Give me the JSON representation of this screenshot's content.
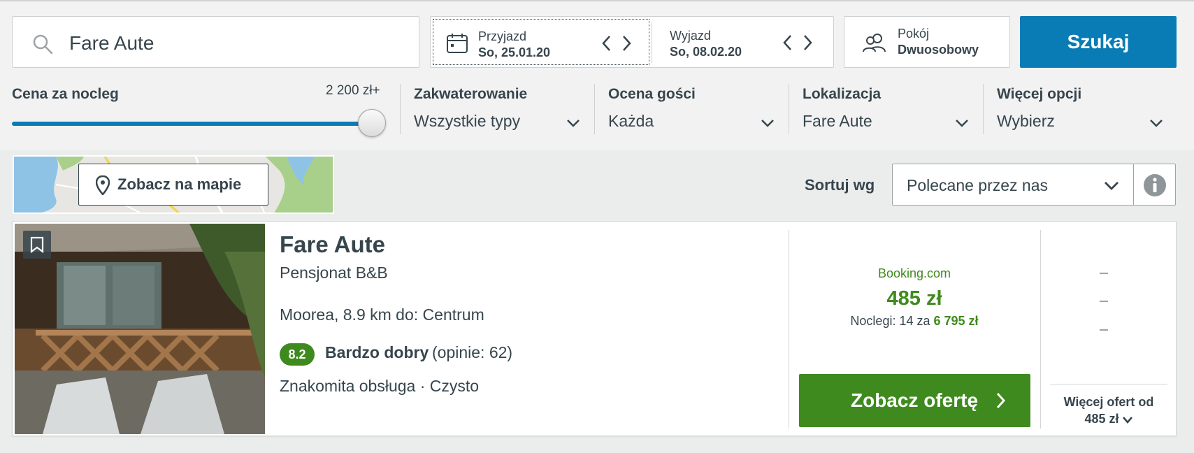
{
  "search": {
    "destination": "Fare Aute",
    "checkin_label": "Przyjazd",
    "checkin_value": "So, 25.01.20",
    "checkout_label": "Wyjazd",
    "checkout_value": "So, 08.02.20",
    "room_label": "Pokój",
    "room_value": "Dwuosobowy",
    "submit_label": "Szukaj"
  },
  "filters": {
    "price": {
      "label": "Cena za nocleg",
      "max_label": "2 200 zł+",
      "slider_fraction": 1.0
    },
    "accommodation": {
      "label": "Zakwaterowanie",
      "value": "Wszystkie typy"
    },
    "rating": {
      "label": "Ocena gości",
      "value": "Każda"
    },
    "location": {
      "label": "Lokalizacja",
      "value": "Fare Aute"
    },
    "more": {
      "label": "Więcej opcji",
      "value": "Wybierz"
    }
  },
  "map": {
    "button_label": "Zobacz na mapie"
  },
  "sort": {
    "label": "Sortuj wg",
    "value": "Polecane przez nas"
  },
  "result": {
    "name": "Fare Aute",
    "type": "Pensjonat B&B",
    "location": "Moorea, 8.9 km do: Centrum",
    "rating_score": "8.2",
    "rating_word": "Bardzo dobry",
    "rating_count": "(opinie: 62)",
    "tag_1": "Znakomita obsługa",
    "tag_sep": "·",
    "tag_2": "Czysto",
    "deal_site": "Booking.com",
    "deal_price": "485 zł",
    "deal_total_prefix": "Noclegi: 14 za",
    "deal_total_value": "6 795 zł",
    "deal_button": "Zobacz ofertę",
    "more_offers_line1": "Więcej ofert od",
    "more_offers_line2": "485 zł"
  },
  "colors": {
    "brand_blue": "#0a7cb5",
    "deal_green": "#3f8a1e",
    "text": "#37454d"
  },
  "icons": [
    "search-icon",
    "calendar-icon",
    "chevron-left-icon",
    "chevron-right-icon",
    "users-icon",
    "chevron-down-icon",
    "map-pin-icon",
    "info-icon",
    "bookmark-icon"
  ]
}
